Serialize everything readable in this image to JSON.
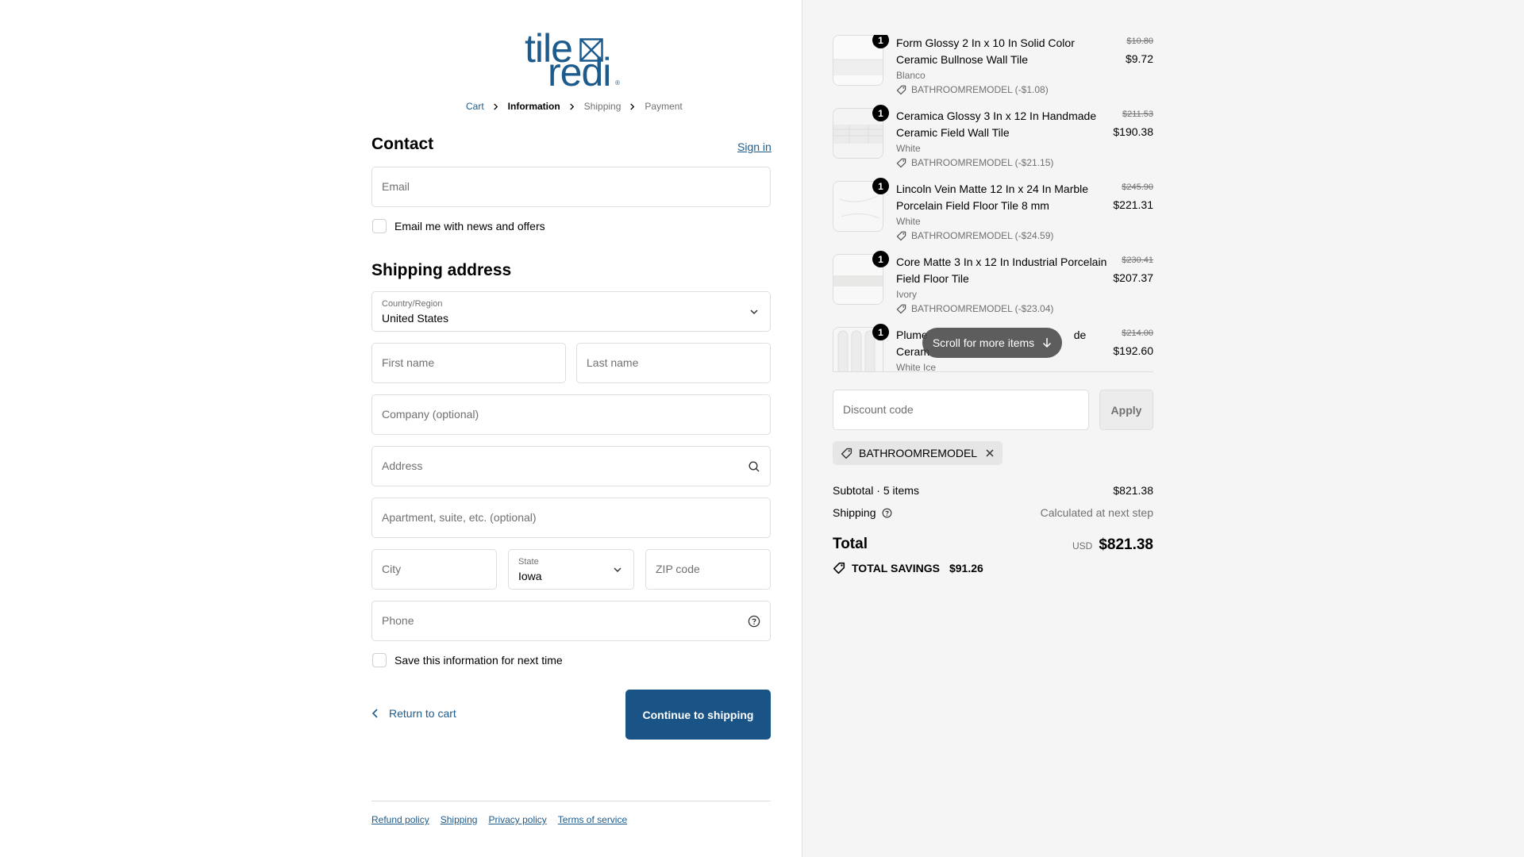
{
  "header": {
    "logo_top": "tile",
    "logo_bottom": "redi",
    "logo_reg": "®"
  },
  "breadcrumb": {
    "cart": "Cart",
    "information": "Information",
    "shipping": "Shipping",
    "payment": "Payment"
  },
  "contact": {
    "title": "Contact",
    "sign_in": "Sign in",
    "email_placeholder": "Email",
    "news_label": "Email me with news and offers"
  },
  "shipping_address": {
    "title": "Shipping address",
    "country_label": "Country/Region",
    "country_value": "United States",
    "first_name_placeholder": "First name",
    "last_name_placeholder": "Last name",
    "company_placeholder": "Company (optional)",
    "address_placeholder": "Address",
    "apartment_placeholder": "Apartment, suite, etc. (optional)",
    "city_placeholder": "City",
    "state_label": "State",
    "state_value": "Iowa",
    "zip_placeholder": "ZIP code",
    "phone_placeholder": "Phone",
    "save_label": "Save this information for next time"
  },
  "actions": {
    "return_label": "Return to cart",
    "continue_label": "Continue to shipping"
  },
  "footer": {
    "links": [
      "Refund policy",
      "Shipping",
      "Privacy policy",
      "Terms of service"
    ]
  },
  "order": {
    "items": [
      {
        "qty": "1",
        "name": "Form Glossy 2 In x 10 In Solid Color Ceramic Bullnose Wall Tile",
        "variant": "Blanco",
        "discount": "BATHROOMREMODEL (-$1.08)",
        "old_price": "$10.80",
        "price": "$9.72"
      },
      {
        "qty": "1",
        "name": "Ceramica Glossy 3 In x 12 In Handmade Ceramic Field Wall Tile",
        "variant": "White",
        "discount": "BATHROOMREMODEL (-$21.15)",
        "old_price": "$211.53",
        "price": "$190.38"
      },
      {
        "qty": "1",
        "name": "Lincoln Vein Matte 12 In x 24 In Marble Porcelain Field Floor Tile 8 mm",
        "variant": "White",
        "discount": "BATHROOMREMODEL (-$24.59)",
        "old_price": "$245.90",
        "price": "$221.31"
      },
      {
        "qty": "1",
        "name": "Core Matte 3 In x 12 In Industrial Porcelain Field Floor Tile",
        "variant": "Ivory",
        "discount": "BATHROOMREMODEL (-$23.04)",
        "old_price": "$230.41",
        "price": "$207.37"
      },
      {
        "qty": "1",
        "name_visible_start": "Plume",
        "name_visible_end": "de",
        "name_line2_start": "Ceram",
        "variant": "White Ice",
        "old_price": "$214.00",
        "price": "$192.60"
      }
    ],
    "scroll_hint": "Scroll for more items",
    "discount_placeholder": "Discount code",
    "apply_label": "Apply",
    "applied_code": "BATHROOMREMODEL",
    "subtotal_label": "Subtotal · 5 items",
    "subtotal_value": "$821.38",
    "shipping_label": "Shipping",
    "shipping_value": "Calculated at next step",
    "total_label": "Total",
    "currency": "USD",
    "total_value": "$821.38",
    "savings_label": "TOTAL SAVINGS",
    "savings_value": "$91.26"
  },
  "colors": {
    "accent": "#1a5385",
    "link": "#1d5b8c",
    "sidebar_bg": "#f5f5f5"
  }
}
